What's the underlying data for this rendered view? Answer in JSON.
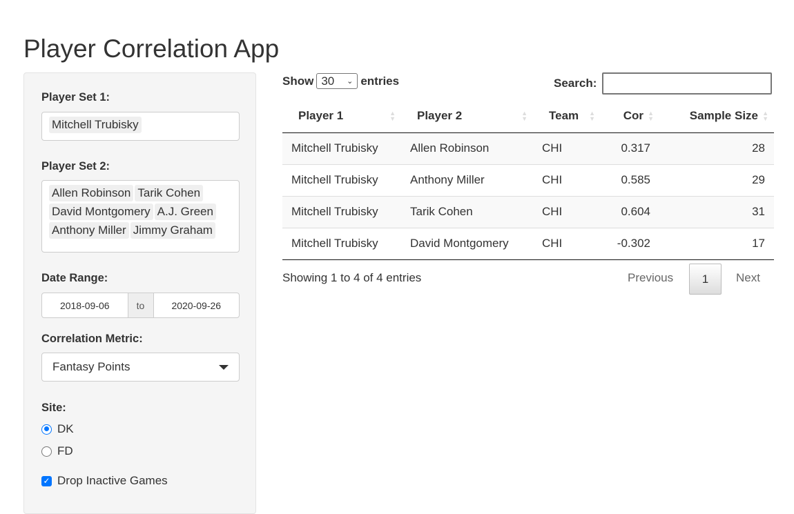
{
  "title": "Player Correlation App",
  "sidebar": {
    "player_set_1": {
      "label": "Player Set 1:",
      "selected": [
        "Mitchell Trubisky"
      ]
    },
    "player_set_2": {
      "label": "Player Set 2:",
      "selected": [
        "Allen Robinson",
        "Tarik Cohen",
        "David Montgomery",
        "A.J. Green",
        "Anthony Miller",
        "Jimmy Graham"
      ]
    },
    "date_range": {
      "label": "Date Range:",
      "start": "2018-09-06",
      "sep": "to",
      "end": "2020-09-26"
    },
    "metric": {
      "label": "Correlation Metric:",
      "value": "Fantasy Points"
    },
    "site": {
      "label": "Site:",
      "options": [
        {
          "label": "DK",
          "checked": true
        },
        {
          "label": "FD",
          "checked": false
        }
      ]
    },
    "drop_inactive": {
      "label": "Drop Inactive Games",
      "checked": true
    }
  },
  "table": {
    "show_label": "Show",
    "entries_label": "entries",
    "length": "30",
    "search_label": "Search:",
    "search_value": "",
    "columns": [
      "Player 1",
      "Player 2",
      "Team",
      "Cor",
      "Sample Size"
    ],
    "rows": [
      [
        "Mitchell Trubisky",
        "Allen Robinson",
        "CHI",
        "0.317",
        "28"
      ],
      [
        "Mitchell Trubisky",
        "Anthony Miller",
        "CHI",
        "0.585",
        "29"
      ],
      [
        "Mitchell Trubisky",
        "Tarik Cohen",
        "CHI",
        "0.604",
        "31"
      ],
      [
        "Mitchell Trubisky",
        "David Montgomery",
        "CHI",
        "-0.302",
        "17"
      ]
    ],
    "info": "Showing 1 to 4 of 4 entries",
    "pagination": {
      "previous": "Previous",
      "page": "1",
      "next": "Next"
    }
  },
  "colors": {
    "accent": "#0075ff",
    "panel": "#f5f5f5"
  }
}
